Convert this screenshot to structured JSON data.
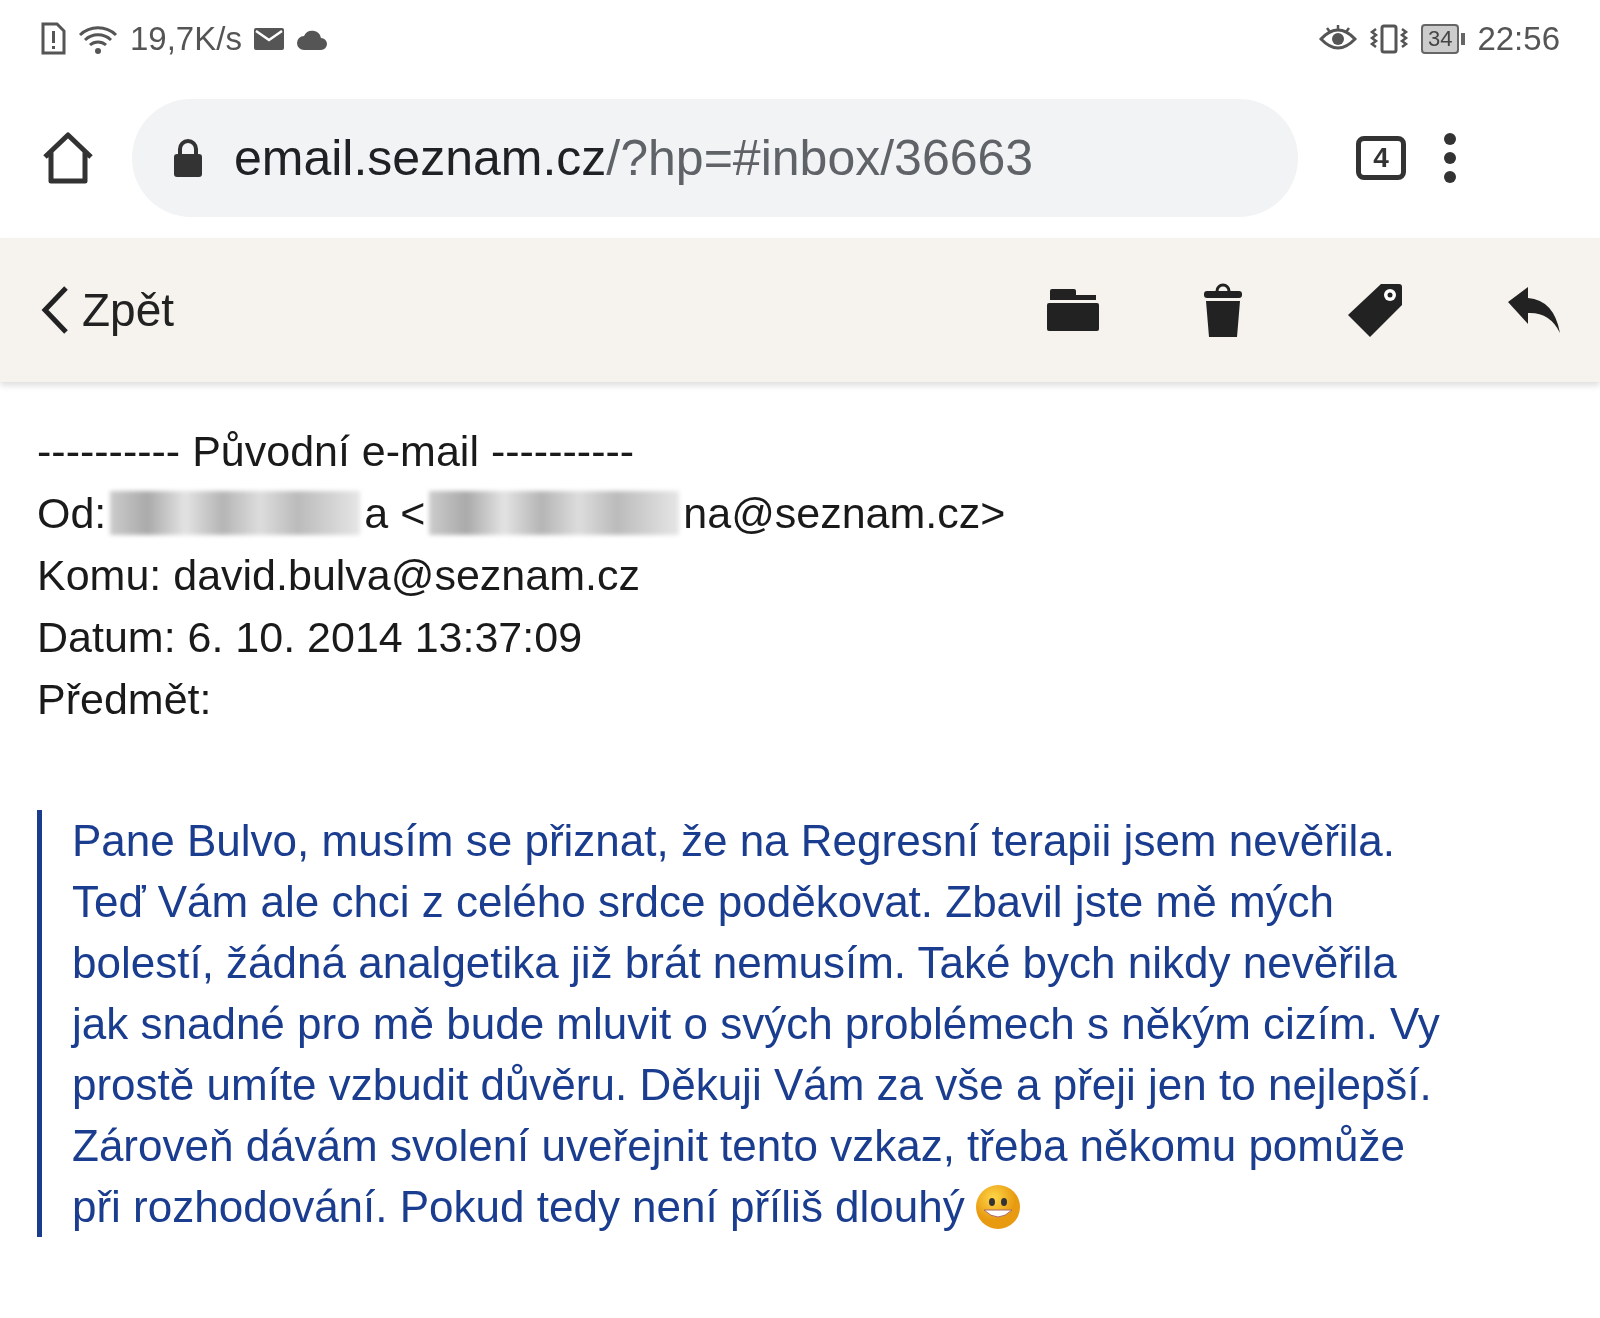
{
  "status_bar": {
    "net_speed": "19,7K/s",
    "battery": "34",
    "time": "22:56"
  },
  "browser": {
    "url_host": "email.seznam.cz",
    "url_rest": "/?hp=#inbox/36663",
    "tab_count": "4"
  },
  "toolbar": {
    "back_label": "Zpět"
  },
  "header": {
    "separator": "---------- Původní e-mail ----------",
    "from": {
      "label": "Od:",
      "parts": [
        {
          "kind": "redacted"
        },
        {
          "kind": "text",
          "text": "a <"
        },
        {
          "kind": "redacted"
        },
        {
          "kind": "text",
          "text": "na@seznam.cz>"
        }
      ]
    },
    "to": "Komu: david.bulva@seznam.cz",
    "date": "Datum: 6. 10. 2014 13:37:09",
    "subject": "Předmět:"
  },
  "quote": {
    "lines": [
      "Pane Bulvo, musím se přiznat, že na Regresní terapii jsem nevěřila.",
      "Teď Vám ale chci z celého srdce poděkovat. Zbavil jste mě mých",
      "bolestí, žádná analgetika již brát nemusím. Také bych nikdy nevěřila",
      "jak snadné pro mě bude mluvit o svých problémech s někým cizím. Vy",
      "prostě umíte vzbudit důvěru. Děkuji Vám za vše a přeji jen to nejlepší.",
      "Zároveň dávám svolení uveřejnit tento vzkaz, třeba někomu pomůže",
      "při rozhodování. Pokud tedy není příliš dlouhý"
    ],
    "ends_with_smiley": true
  }
}
